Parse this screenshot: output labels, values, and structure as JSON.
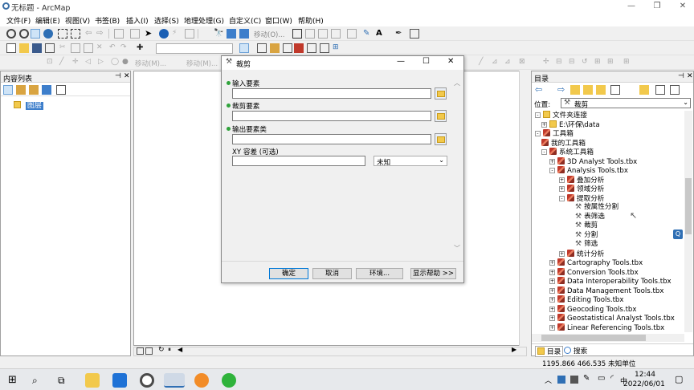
{
  "window": {
    "title": "无标题 - ArcMap"
  },
  "menu": [
    "文件(F)",
    "编辑(E)",
    "视图(V)",
    "书签(B)",
    "插入(I)",
    "选择(S)",
    "地理处理(G)",
    "自定义(C)",
    "窗口(W)",
    "帮助(H)"
  ],
  "toolbar": {
    "pan_zoom_label": "移动(O)...",
    "disabled_1": "移动(M)...",
    "disabled_2": "移动(M)...",
    "text_tool": "A"
  },
  "toc": {
    "title": "内容列表",
    "layer": "图层"
  },
  "catalog": {
    "title": "目录",
    "location_label": "位置:",
    "location_value": "裁剪",
    "tree": [
      {
        "t": "文件夹连接",
        "x": 4,
        "pm": "-",
        "icon": "fld"
      },
      {
        "t": "E:\\环保\\data",
        "x": 12,
        "pm": "+",
        "icon": "fld"
      },
      {
        "t": "工具箱",
        "x": 4,
        "pm": "-",
        "icon": "tbx"
      },
      {
        "t": "我的工具箱",
        "x": 12,
        "pm": "",
        "icon": "tbx"
      },
      {
        "t": "系统工具箱",
        "x": 12,
        "pm": "-",
        "icon": "tbx"
      },
      {
        "t": "3D Analyst Tools.tbx",
        "x": 22,
        "pm": "+",
        "icon": "tbx"
      },
      {
        "t": "Analysis Tools.tbx",
        "x": 22,
        "pm": "-",
        "icon": "tbx"
      },
      {
        "t": "叠加分析",
        "x": 34,
        "pm": "+",
        "icon": "tbx"
      },
      {
        "t": "领域分析",
        "x": 34,
        "pm": "+",
        "icon": "tbx"
      },
      {
        "t": "提取分析",
        "x": 34,
        "pm": "-",
        "icon": "tbx"
      },
      {
        "t": "按属性分割",
        "x": 54,
        "pm": "",
        "icon": "tool"
      },
      {
        "t": "表筛选",
        "x": 54,
        "pm": "",
        "icon": "tool"
      },
      {
        "t": "裁剪",
        "x": 54,
        "pm": "",
        "icon": "tool"
      },
      {
        "t": "分割",
        "x": 54,
        "pm": "",
        "icon": "tool"
      },
      {
        "t": "筛选",
        "x": 54,
        "pm": "",
        "icon": "tool"
      },
      {
        "t": "统计分析",
        "x": 34,
        "pm": "+",
        "icon": "tbx"
      },
      {
        "t": "Cartography Tools.tbx",
        "x": 22,
        "pm": "+",
        "icon": "tbx"
      },
      {
        "t": "Conversion Tools.tbx",
        "x": 22,
        "pm": "+",
        "icon": "tbx"
      },
      {
        "t": "Data Interoperability Tools.tbx",
        "x": 22,
        "pm": "+",
        "icon": "tbx"
      },
      {
        "t": "Data Management Tools.tbx",
        "x": 22,
        "pm": "+",
        "icon": "tbx"
      },
      {
        "t": "Editing Tools.tbx",
        "x": 22,
        "pm": "+",
        "icon": "tbx"
      },
      {
        "t": "Geocoding Tools.tbx",
        "x": 22,
        "pm": "+",
        "icon": "tbx"
      },
      {
        "t": "Geostatistical Analyst Tools.tbx",
        "x": 22,
        "pm": "+",
        "icon": "tbx"
      },
      {
        "t": "Linear Referencing Tools.tbx",
        "x": 22,
        "pm": "+",
        "icon": "tbx"
      }
    ],
    "tab_catalog": "目录",
    "tab_search": "搜索"
  },
  "dialog": {
    "title": "裁剪",
    "input_features": "输入要素",
    "clip_features": "裁剪要素",
    "output_class": "输出要素类",
    "xy_tolerance": "XY 容差 (可选)",
    "unit_value": "未知",
    "ok": "确定",
    "cancel": "取消",
    "env": "环境...",
    "help": "显示帮助 >>"
  },
  "status": {
    "coords": "1195.866  466.535 未知单位"
  },
  "taskbar": {
    "time": "12:44",
    "date": "2022/06/01",
    "lang": "中",
    "badge": "Q"
  }
}
